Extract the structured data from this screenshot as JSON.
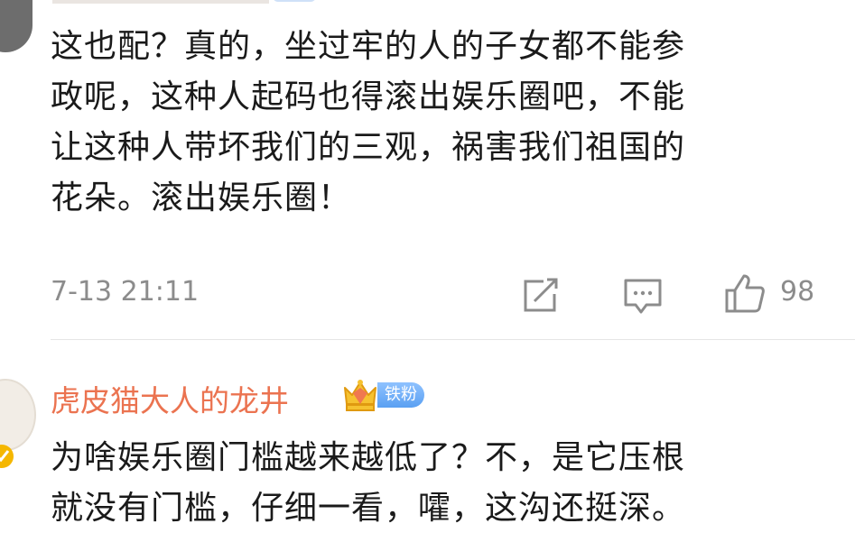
{
  "comments": [
    {
      "text_lines": [
        "这也配？真的，坐过牢的人的子女都不能参",
        "政呢，这种人起码也得滚出娱乐圈吧，不能",
        "让这种人带坏我们的三观，祸害我们祖国的",
        "花朵。滚出娱乐圈！"
      ],
      "timestamp": "7-13 21:11",
      "like_count": "98"
    },
    {
      "username": "虎皮猫大人的龙井",
      "badge": "铁粉",
      "text_lines": [
        "为啥娱乐圈门槛越来越低了？不，是它压根",
        "就没有门槛，仔细一看，嚯，这沟还挺深。"
      ]
    }
  ],
  "icons": [
    "repost-icon",
    "comment-icon",
    "like-icon",
    "crown-badge-icon",
    "verified-icon"
  ],
  "colors": {
    "username": "#eb7350",
    "meta": "#8c8c8c",
    "badge": "#5aa0f2",
    "verified": "#f5b700"
  }
}
